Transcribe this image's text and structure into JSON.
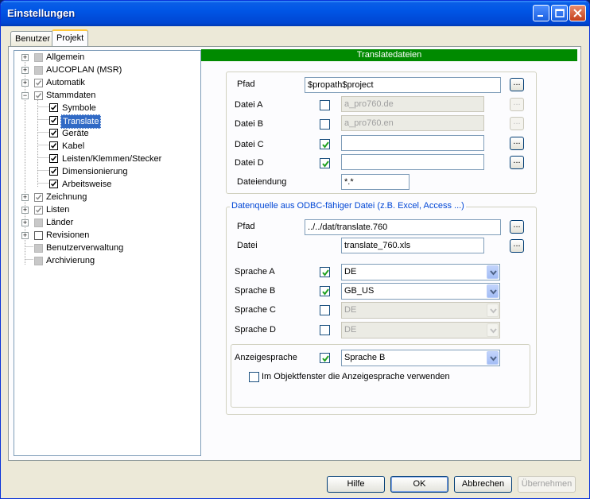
{
  "window": {
    "title": "Einstellungen"
  },
  "tabs": [
    {
      "label": "Benutzer"
    },
    {
      "label": "Projekt"
    }
  ],
  "tree": {
    "items": [
      {
        "label": "Allgemein"
      },
      {
        "label": "AUCOPLAN (MSR)"
      },
      {
        "label": "Automatik"
      },
      {
        "label": "Stammdaten"
      },
      {
        "label": "Symbole"
      },
      {
        "label": "Translate"
      },
      {
        "label": "Geräte"
      },
      {
        "label": "Kabel"
      },
      {
        "label": "Leisten/Klemmen/Stecker"
      },
      {
        "label": "Dimensionierung"
      },
      {
        "label": "Arbeitsweise"
      },
      {
        "label": "Zeichnung"
      },
      {
        "label": "Listen"
      },
      {
        "label": "Länder"
      },
      {
        "label": "Revisionen"
      },
      {
        "label": "Benutzerverwaltung"
      },
      {
        "label": "Archivierung"
      }
    ]
  },
  "panel": {
    "header": "Translatedateien",
    "pfad_label": "Pfad",
    "pfad_value": "$propath$project",
    "datei_a_label": "Datei A",
    "datei_a_value": "a_pro760.de",
    "datei_b_label": "Datei B",
    "datei_b_value": "a_pro760.en",
    "datei_c_label": "Datei C",
    "datei_c_value": "",
    "datei_d_label": "Datei D",
    "datei_d_value": "",
    "dateiendung_label": "Dateiendung",
    "dateiendung_value": "*.*",
    "browse_label": "...",
    "odbc": {
      "title": "Datenquelle aus ODBC-fähiger Datei (z.B. Excel, Access ...)",
      "pfad_label": "Pfad",
      "pfad_value": "../../dat/translate.760",
      "datei_label": "Datei",
      "datei_value": "translate_760.xls",
      "sprache_a_label": "Sprache A",
      "sprache_a_value": "DE",
      "sprache_b_label": "Sprache B",
      "sprache_b_value": "GB_US",
      "sprache_c_label": "Sprache C",
      "sprache_c_value": "DE",
      "sprache_d_label": "Sprache D",
      "sprache_d_value": "DE",
      "anzeige_label": "Anzeigesprache",
      "anzeige_value": "Sprache B",
      "objektfenster_label": "Im Objektfenster die Anzeigesprache verwenden"
    }
  },
  "buttons": {
    "hilfe": "Hilfe",
    "ok": "OK",
    "abbrechen": "Abbrechen",
    "uebernehmen": "Übernehmen"
  },
  "colors": {
    "header_green": "#008a00",
    "group_title_blue": "#0046d5",
    "check_green": "#21a121"
  }
}
